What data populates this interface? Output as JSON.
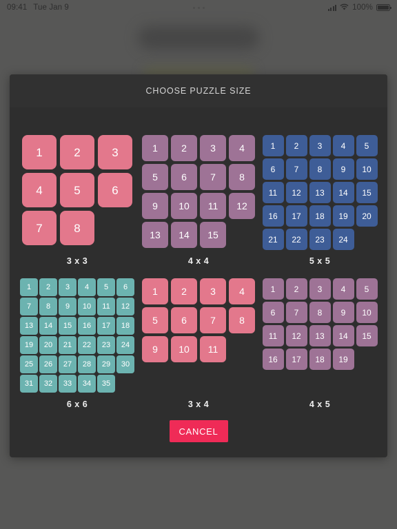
{
  "status_bar": {
    "time": "09:41",
    "date": "Tue Jan 9",
    "battery_percent": "100%",
    "signal_icon": "cellular-bars-icon",
    "wifi_icon": "wifi-icon",
    "battery_icon": "battery-full-icon",
    "center_icon": "three-dots-icon"
  },
  "dialog": {
    "title": "CHOOSE PUZZLE SIZE",
    "cancel_label": "CANCEL"
  },
  "colors": {
    "dialog_bg": "#2e2e2e",
    "dialog_header_bg": "#313131",
    "page_bg": "#5a5a59",
    "accent_cancel": "#ef2b57",
    "salmon": "#e3788c",
    "mauve": "#9e7396",
    "blue": "#3e5d97",
    "teal": "#6cb3b0"
  },
  "options": [
    {
      "name": "puzzle-size-3x3",
      "label": "3 x 3",
      "cols": 3,
      "rows": 3,
      "tile_size": 50,
      "gap": 5,
      "font_size": 17,
      "color": "#e3788c",
      "tiles": [
        1,
        2,
        3,
        4,
        5,
        6,
        7,
        8
      ]
    },
    {
      "name": "puzzle-size-4x4",
      "label": "4 x 4",
      "cols": 4,
      "rows": 4,
      "tile_size": 38,
      "gap": 4,
      "font_size": 14,
      "color": "#9e7396",
      "tiles": [
        1,
        2,
        3,
        4,
        5,
        6,
        7,
        8,
        9,
        10,
        11,
        12,
        13,
        14,
        15
      ]
    },
    {
      "name": "puzzle-size-5x5",
      "label": "5 x 5",
      "cols": 5,
      "rows": 5,
      "tile_size": 31,
      "gap": 3,
      "font_size": 12,
      "color": "#3e5d97",
      "tiles": [
        1,
        2,
        3,
        4,
        5,
        6,
        7,
        8,
        9,
        10,
        11,
        12,
        13,
        14,
        15,
        16,
        17,
        18,
        19,
        20,
        21,
        22,
        23,
        24
      ]
    },
    {
      "name": "puzzle-size-6x6",
      "label": "6 x 6",
      "cols": 6,
      "rows": 6,
      "tile_size": 26,
      "gap": 2,
      "font_size": 11,
      "color": "#6cb3b0",
      "tiles": [
        1,
        2,
        3,
        4,
        5,
        6,
        7,
        8,
        9,
        10,
        11,
        12,
        13,
        14,
        15,
        16,
        17,
        18,
        19,
        20,
        21,
        22,
        23,
        24,
        25,
        26,
        27,
        28,
        29,
        30,
        31,
        32,
        33,
        34,
        35
      ]
    },
    {
      "name": "puzzle-size-3x4",
      "label": "3 x 4",
      "cols": 4,
      "rows": 3,
      "tile_size": 38,
      "gap": 4,
      "font_size": 14,
      "color": "#e3788c",
      "tiles": [
        1,
        2,
        3,
        4,
        5,
        6,
        7,
        8,
        9,
        10,
        11
      ]
    },
    {
      "name": "puzzle-size-4x5",
      "label": "4 x 5",
      "cols": 5,
      "rows": 4,
      "tile_size": 31,
      "gap": 3,
      "font_size": 12,
      "color": "#9e7396",
      "tiles": [
        1,
        2,
        3,
        4,
        5,
        6,
        7,
        8,
        9,
        10,
        11,
        12,
        13,
        14,
        15,
        16,
        17,
        18,
        19
      ]
    }
  ]
}
